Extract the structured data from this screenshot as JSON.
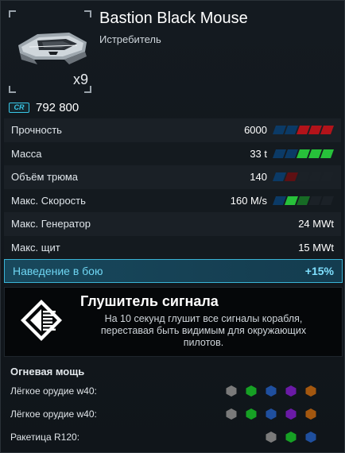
{
  "ship": {
    "name": "Bastion Black Mouse",
    "class": "Истребитель",
    "count": "x9",
    "currency": "CR",
    "price": "792 800"
  },
  "stats": [
    {
      "label": "Прочность",
      "value": "6000",
      "bars": [
        "blue",
        "blue",
        "red",
        "red",
        "red"
      ]
    },
    {
      "label": "Масса",
      "value": "33 t",
      "bars": [
        "blue",
        "blue",
        "green",
        "green",
        "green"
      ]
    },
    {
      "label": "Объём трюма",
      "value": "140",
      "bars": [
        "blue",
        "dred",
        "empty",
        "empty",
        "empty"
      ]
    },
    {
      "label": "Макс. Скорость",
      "value": "160 M/s",
      "bars": [
        "blue",
        "green",
        "dgreen",
        "empty",
        "empty"
      ]
    },
    {
      "label": "Макс. Генератор",
      "value": "24 MWt",
      "bars": []
    },
    {
      "label": "Макс. щит",
      "value": "15 MWt",
      "bars": []
    }
  ],
  "highlight": {
    "label": "Наведение в бою",
    "value": "+15%"
  },
  "ability": {
    "title": "Глушитель сигнала",
    "description": "На 10 секунд глушит все сигналы корабля, переставая быть видимым для окружающих пилотов.",
    "icon": "signal-jammer-icon"
  },
  "firepower": {
    "title": "Огневая мощь",
    "weapons": [
      {
        "label": "Лёгкое орудие w40:",
        "slots": [
          "#7a7a7a",
          "#16a024",
          "#1f4f9e",
          "#6a1aa6",
          "#a3570f"
        ]
      },
      {
        "label": "Лёгкое орудие w40:",
        "slots": [
          "#7a7a7a",
          "#16a024",
          "#1f4f9e",
          "#6a1aa6",
          "#a3570f"
        ]
      },
      {
        "label": "Ракетица R120:",
        "slots": [
          "#7a7a7a",
          "#16a024",
          "#1f4f9e"
        ]
      }
    ]
  }
}
